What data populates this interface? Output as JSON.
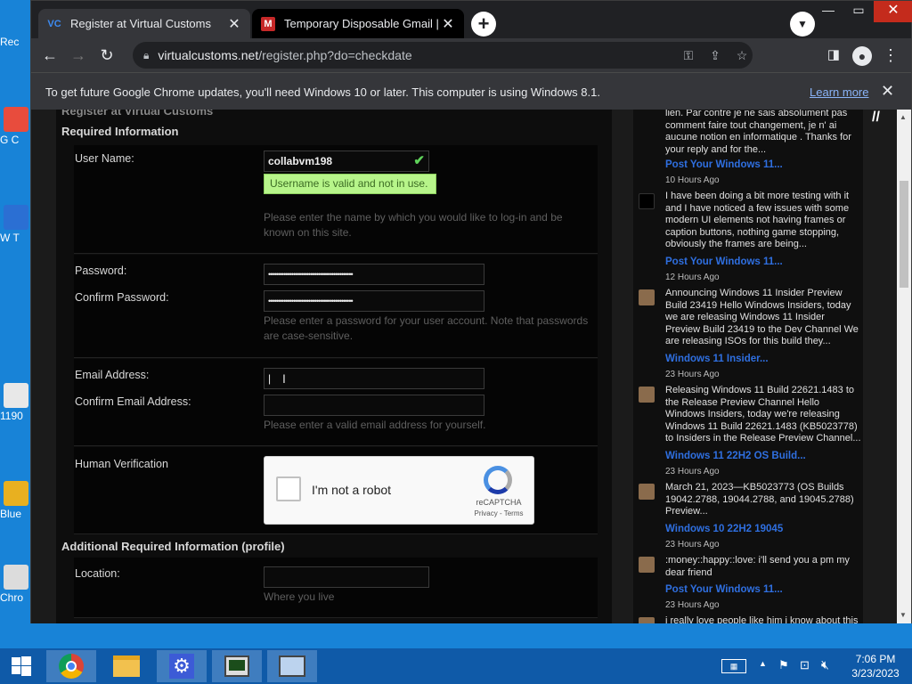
{
  "desktop": {
    "icons": [
      {
        "label": "Rec",
        "color": "#dfe9f5"
      },
      {
        "label": "G C",
        "color": "#e84c3d"
      },
      {
        "label": "W T",
        "color": "#2b6fd3"
      },
      {
        "label": "1190",
        "color": "#e8e8e8"
      },
      {
        "label": "Blue",
        "color": "#e8b020"
      },
      {
        "label": "Chro",
        "color": "#dcdcdc"
      }
    ]
  },
  "browser": {
    "tabs": [
      {
        "title": "Register at Virtual Customs",
        "favicon": "vc-logo-icon",
        "active": true
      },
      {
        "title": "Temporary Disposable Gmail | Te",
        "favicon": "gmail-icon",
        "active": false
      }
    ],
    "url_host": "virtualcustoms.net",
    "url_path": "/register.php?do=checkdate",
    "infobar": {
      "message": "To get future Google Chrome updates, you'll need Windows 10 or later. This computer is using Windows 8.1.",
      "link": "Learn more"
    }
  },
  "page": {
    "cut_heading": "Register at Virtual Customs",
    "required_heading": "Required Information",
    "username": {
      "label": "User Name:",
      "value": "collabvm198",
      "valid_msg": "Username is valid and not in use.",
      "hint": "Please enter the name by which you would like to log-in and be known on this site."
    },
    "password": {
      "label": "Password:",
      "confirm_label": "Confirm Password:",
      "value": "••••••••••••••••••••••••••••••••••••••••••••",
      "confirm_value": "••••••••••••••••••••••••••••••••••••••••••••",
      "hint": "Please enter a password for your user account. Note that passwords are case-sensitive."
    },
    "email": {
      "label": "Email Address:",
      "confirm_label": "Confirm Email Address:",
      "value": "|",
      "hint": "Please enter a valid email address for yourself."
    },
    "verification": {
      "label": "Human Verification",
      "checkbox_text": "I'm not a robot",
      "brand": "reCAPTCHA",
      "links": "Privacy - Terms"
    },
    "additional_heading": "Additional Required Information (profile)",
    "location": {
      "label": "Location:",
      "hint": "Where you live"
    }
  },
  "sidebar": {
    "posts": [
      {
        "text": "lien. Par contre je ne sais absolument pas comment faire tout changement, je n' ai aucune notion en informatique . Thanks for your reply and for the...",
        "link": "Post Your Windows 11...",
        "time": "10 Hours Ago"
      },
      {
        "text": "I have been doing a bit more testing with it and I have noticed a few issues with some modern UI elements not having frames or caption buttons, nothing game stopping, obviously the frames are being...",
        "link": "Post Your Windows 11...",
        "time": "12 Hours Ago"
      },
      {
        "text": "Announcing Windows 11 Insider Preview Build 23419 Hello Windows Insiders, today we are releasing Windows 11 Insider Preview Build 23419 to the Dev Channel We are releasing ISOs for this build they...",
        "link": "Windows 11 Insider...",
        "time": "23 Hours Ago"
      },
      {
        "text": "Releasing Windows 11 Build 22621.1483 to the Release Preview Channel Hello Windows Insiders, today we're releasing Windows 11 Build 22621.1483 (KB5023778) to Insiders in the Release Preview Channel...",
        "link": "Windows 11 22H2 OS Build...",
        "time": "23 Hours Ago"
      },
      {
        "text": "March 21, 2023—KB5023773 (OS Builds 19042.2788, 19044.2788, and 19045.2788) Preview...",
        "link": "Windows 10 22H2 19045",
        "time": "23 Hours Ago"
      },
      {
        "text": ":money::happy::love: i'll send you a pm my dear friend",
        "link": "Post Your Windows 11...",
        "time": "23 Hours Ago"
      },
      {
        "text": "i really love people like him i know about this",
        "link": "",
        "time": ""
      }
    ]
  },
  "taskbar": {
    "apps": [
      "chrome-icon",
      "file-explorer-icon",
      "settings-gear-icon",
      "task-manager-icon",
      "remote-desktop-icon"
    ],
    "time": "7:06 PM",
    "date": "3/23/2023"
  }
}
